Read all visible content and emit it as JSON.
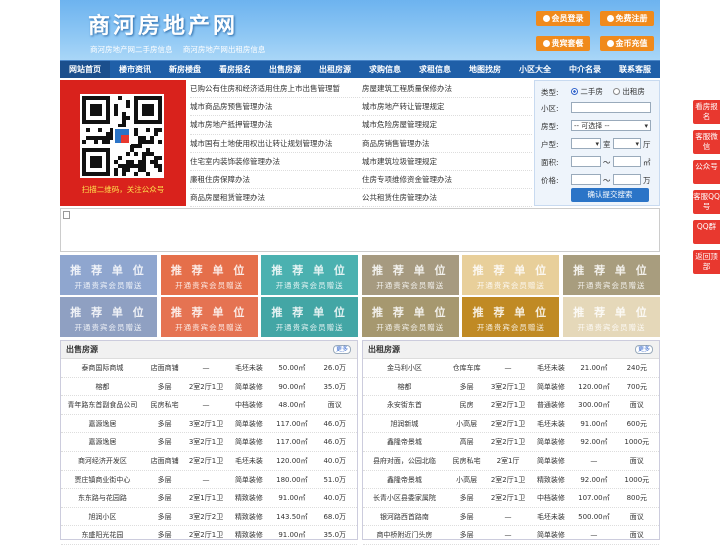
{
  "header": {
    "logo": "商河房地产网",
    "sublinks": [
      "商河房地产网二手房信息",
      "商河房地产网出租房信息"
    ],
    "buttons": [
      {
        "label": "会员登录",
        "icon": "user-icon"
      },
      {
        "label": "免费注册",
        "icon": "register-icon"
      },
      {
        "label": "贵宾套餐",
        "icon": "vip-icon"
      },
      {
        "label": "金币充值",
        "icon": "coin-icon"
      }
    ]
  },
  "nav": [
    "网站首页",
    "楼市资讯",
    "新房楼盘",
    "看房报名",
    "出售房源",
    "出租房源",
    "求购信息",
    "求租信息",
    "地图找房",
    "小区大全",
    "中介名录",
    "联系客服"
  ],
  "qr": {
    "caption": "扫描二维码，关注公众号"
  },
  "links": {
    "left": [
      "已购公有住房和经济适用住房上市出售管理暂",
      "城市商品房预售管理办法",
      "城市房地产抵押管理办法",
      "城市国有土地使用权出让转让规划管理办法",
      "住宅室内装饰装修管理办法",
      "廉租住房保障办法",
      "商品房屋租赁管理办法"
    ],
    "right": [
      "房屋建筑工程质量保修办法",
      "城市房地产转让管理规定",
      "城市危险房屋管理规定",
      "商品房销售管理办法",
      "城市建筑垃圾管理规定",
      "住房专项维修资金管理办法",
      "公共租赁住房管理办法"
    ]
  },
  "search": {
    "type_label": "类型:",
    "opt_sale": "二手房",
    "opt_rent": "出租房",
    "community_label": "小区:",
    "housetype_label": "房型:",
    "housetype_value": "-- 可选择 --",
    "layout_label": "户型:",
    "room_unit": "室",
    "hall_unit": "厅",
    "area_label": "面积:",
    "area_unit": "㎡",
    "price_label": "价格:",
    "price_unit": "万",
    "range_sep": "～",
    "submit": "确认提交搜索"
  },
  "tiles": {
    "title": "推 荐 单 位",
    "subtitle": "开通贵宾会员赠送",
    "colors": [
      "#8fa6cf",
      "#e56f4a",
      "#4bb1b0",
      "#a69a80",
      "#e8cf9a",
      "#a89d7e",
      "#8fa0c2",
      "#e57352",
      "#43a6a5",
      "#a6986f",
      "#c08a24",
      "#e5d8b9"
    ]
  },
  "sale": {
    "title": "出售房源",
    "more": "更多",
    "rows": [
      [
        "泰商国际商城",
        "店面商铺",
        "—",
        "毛坯未装",
        "50.00㎡",
        "26.0万"
      ],
      [
        "榕都",
        "多层",
        "2室2厅1卫",
        "简单装修",
        "90.00㎡",
        "35.0万"
      ],
      [
        "青年路东首副食品公司",
        "民房私宅",
        "—",
        "中档装修",
        "48.00㎡",
        "面议"
      ],
      [
        "嘉源逸居",
        "多层",
        "3室2厅1卫",
        "简单装修",
        "117.00㎡",
        "46.0万"
      ],
      [
        "嘉源逸居",
        "多层",
        "3室2厅1卫",
        "简单装修",
        "117.00㎡",
        "46.0万"
      ],
      [
        "商河经济开发区",
        "店面商铺",
        "2室2厅1卫",
        "毛坯未装",
        "120.00㎡",
        "40.0万"
      ],
      [
        "贾庄镇商业街中心",
        "多层",
        "—",
        "简单装修",
        "180.00㎡",
        "51.0万"
      ],
      [
        "东东路与花园路",
        "多层",
        "2室1厅1卫",
        "精致装修",
        "91.00㎡",
        "40.0万"
      ],
      [
        "旭润小区",
        "多层",
        "3室2厅2卫",
        "精致装修",
        "143.50㎡",
        "68.0万"
      ],
      [
        "东盛阳光花园",
        "多层",
        "2室2厅1卫",
        "精致装修",
        "91.00㎡",
        "35.0万"
      ]
    ]
  },
  "rent": {
    "title": "出租房源",
    "more": "更多",
    "rows": [
      [
        "金马利小区",
        "仓库车库",
        "—",
        "毛坯未装",
        "21.00㎡",
        "240元"
      ],
      [
        "榕都",
        "多层",
        "3室2厅1卫",
        "简单装修",
        "120.00㎡",
        "700元"
      ],
      [
        "永安街东首",
        "民房",
        "2室2厅1卫",
        "普通装修",
        "300.00㎡",
        "面议"
      ],
      [
        "旭润新城",
        "小高层",
        "2室2厅1卫",
        "毛坯未装",
        "91.00㎡",
        "600元"
      ],
      [
        "鑫隆帝景城",
        "高层",
        "2室2厅1卫",
        "简单装修",
        "92.00㎡",
        "1000元"
      ],
      [
        "县府对面，公园北临",
        "民房私宅",
        "2室1厅",
        "简单装修",
        "—",
        "面议"
      ],
      [
        "鑫隆帝景城",
        "小高层",
        "2室2厅1卫",
        "精致装修",
        "92.00㎡",
        "1000元"
      ],
      [
        "长青小区县委家属院",
        "多层",
        "2室2厅1卫",
        "中档装修",
        "107.00㎡",
        "800元"
      ],
      [
        "银河路西首路南",
        "多层",
        "—",
        "毛坯未装",
        "500.00㎡",
        "面议"
      ],
      [
        "商中桥附近门头房",
        "多层",
        "—",
        "简单装修",
        "—",
        "面议"
      ]
    ]
  },
  "sidebar": [
    "看房报名",
    "客服微信",
    "公众号",
    "客服QQ号",
    "QQ群",
    "返回顶部"
  ]
}
